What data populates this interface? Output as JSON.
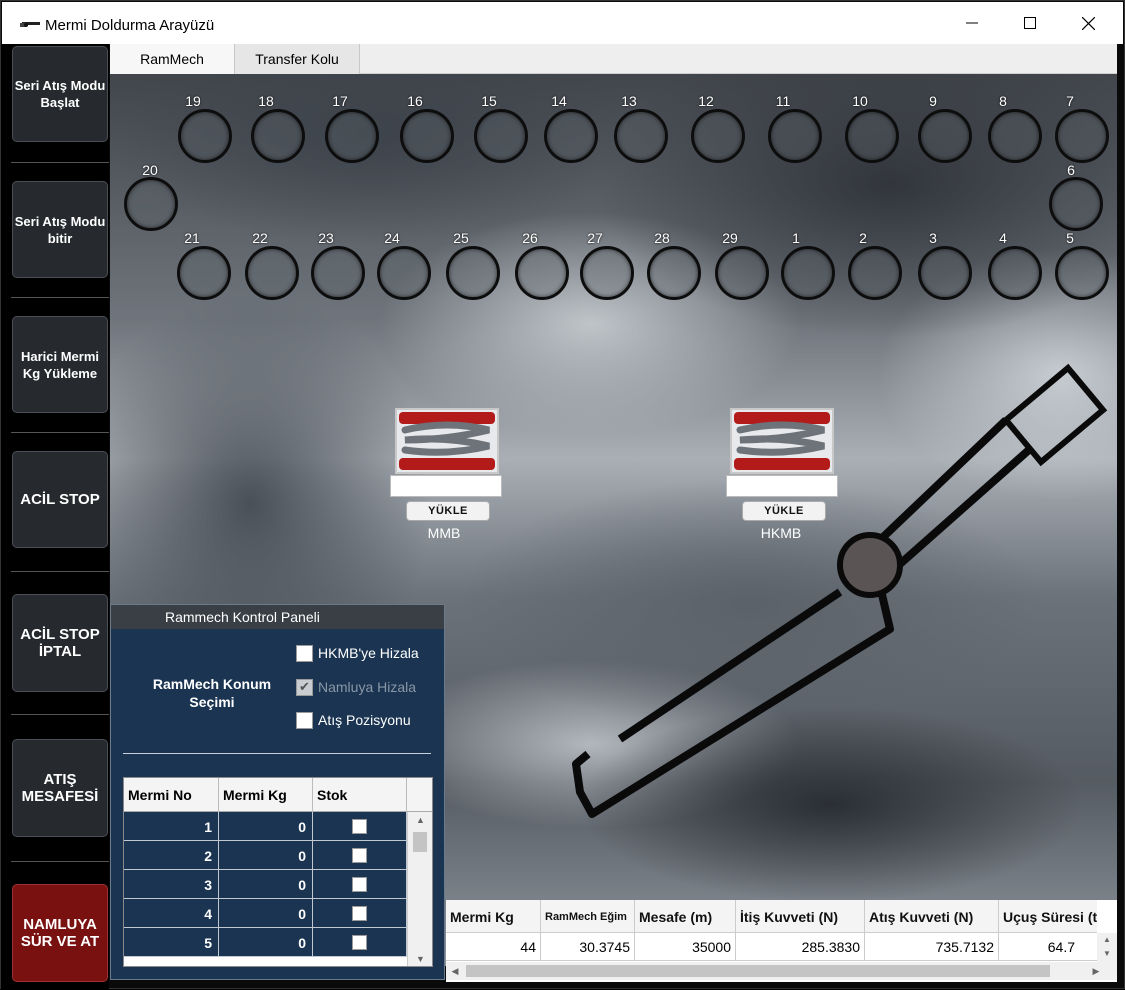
{
  "window": {
    "title": "Mermi Doldurma Arayüzü",
    "minimize": "—",
    "maximize": "☐",
    "close": "✕"
  },
  "sidebar": {
    "buttons": [
      {
        "label": "Seri Atış Modu Başlat"
      },
      {
        "label": "Seri Atış Modu bitir"
      },
      {
        "label": "Harici Mermi Kg Yükleme"
      },
      {
        "label": "ACİL STOP"
      },
      {
        "label": "ACİL STOP İPTAL"
      },
      {
        "label": "ATIŞ MESAFESİ"
      },
      {
        "label": "NAMLUYA SÜR VE AT"
      }
    ]
  },
  "tabs": [
    {
      "label": "RamMech",
      "active": true
    },
    {
      "label": "Transfer Kolu",
      "active": false
    }
  ],
  "slots": {
    "top_row": [
      "19",
      "18",
      "17",
      "16",
      "15",
      "14",
      "13",
      "12",
      "11",
      "10",
      "9",
      "8",
      "7"
    ],
    "middle_left": "20",
    "middle_right": "6",
    "bottom_row": [
      "21",
      "22",
      "23",
      "24",
      "25",
      "26",
      "27",
      "28",
      "29",
      "1",
      "2",
      "3",
      "4",
      "5"
    ]
  },
  "magazines": [
    {
      "name": "MMB",
      "button": "YÜKLE",
      "field_value": ""
    },
    {
      "name": "HKMB",
      "button": "YÜKLE",
      "field_value": ""
    }
  ],
  "panel": {
    "title": "Rammech Kontrol Paneli",
    "konum_title": "RamMech Konum Seçimi",
    "options": [
      {
        "label": "HKMB'ye Hizala",
        "checked": false,
        "disabled": false
      },
      {
        "label": "Namluya Hizala",
        "checked": true,
        "disabled": true
      },
      {
        "label": "Atış Pozisyonu",
        "checked": false,
        "disabled": false
      }
    ],
    "table": {
      "headers": [
        "Mermi No",
        "Mermi Kg",
        "Stok"
      ],
      "rows": [
        {
          "no": "1",
          "kg": "0"
        },
        {
          "no": "2",
          "kg": "0"
        },
        {
          "no": "3",
          "kg": "0"
        },
        {
          "no": "4",
          "kg": "0"
        },
        {
          "no": "5",
          "kg": "0"
        }
      ]
    }
  },
  "data_table": {
    "headers": [
      "Mermi Kg",
      "RamMech Eğim",
      "Mesafe (m)",
      "İtiş Kuvveti (N)",
      "Atış Kuvveti (N)",
      "Uçuş Süresi (t"
    ],
    "row": [
      "44",
      "30.3745",
      "35000",
      "285.3830",
      "735.7132",
      "64.7"
    ]
  },
  "colors": {
    "panel_bg": "#1a3452",
    "danger": "#7a1111",
    "button_bg": "#262a2e"
  }
}
